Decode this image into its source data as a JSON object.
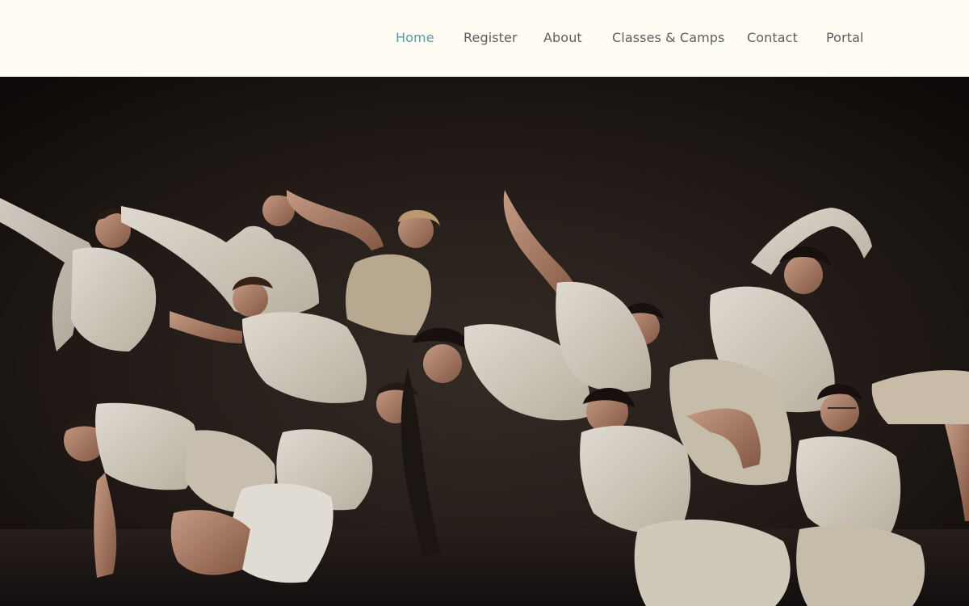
{
  "nav": {
    "items": [
      {
        "label": "Home",
        "active": true
      },
      {
        "label": "Register",
        "active": false
      },
      {
        "label": "About",
        "active": false
      },
      {
        "label": "Classes & Camps",
        "active": false
      },
      {
        "label": "Contact",
        "active": false
      },
      {
        "label": "Portal",
        "active": false
      }
    ],
    "active_color": "#5a9aa3",
    "text_color": "#5a5f63"
  },
  "header": {
    "background": "#fffcf3"
  },
  "hero": {
    "subject": "group-of-dancers-photo",
    "background": "#1b1614",
    "costume_color": "#e8e0d3"
  }
}
